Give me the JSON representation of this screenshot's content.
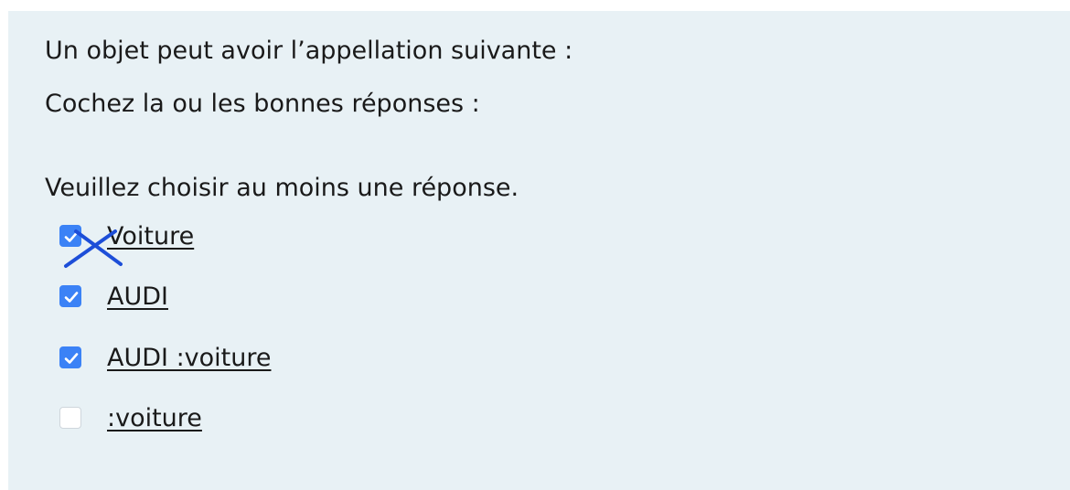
{
  "question": {
    "prompt": "Un objet peut avoir l’appellation suivante :",
    "instruction": "Cochez la ou les bonnes réponses :",
    "warning": "Veuillez choisir au moins une réponse."
  },
  "options": [
    {
      "label": "Voiture",
      "checked": true,
      "marked_wrong": true
    },
    {
      "label": "AUDI",
      "checked": true
    },
    {
      "label": "AUDI :voiture",
      "checked": true
    },
    {
      "label": ":voiture",
      "checked": false
    }
  ],
  "colors": {
    "panel_background": "#e8f1f5",
    "checkbox_checked": "#3b82f6",
    "wrong_mark": "#1d4ed8"
  },
  "icons": {
    "check": "checkmark-icon",
    "wrong": "cross-mark-icon"
  }
}
